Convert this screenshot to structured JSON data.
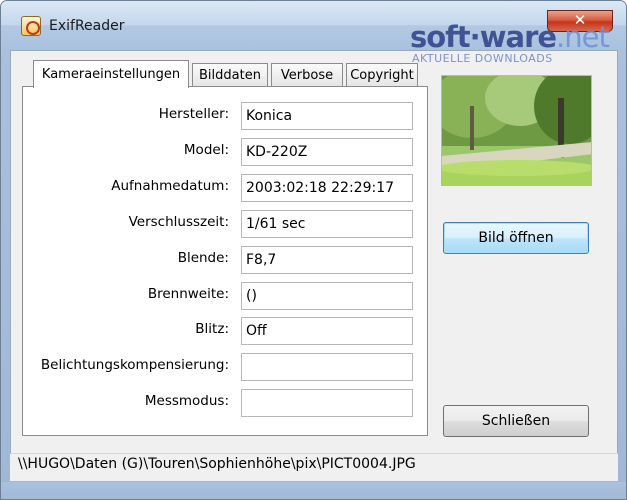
{
  "window": {
    "title": "ExifReader",
    "close_glyph": "✕"
  },
  "watermark": {
    "brand_main": "soft",
    "brand_sep": "·",
    "brand_mid": "ware",
    "brand_tld": ".net",
    "tagline": "AKTUELLE DOWNLOADS"
  },
  "tabs": [
    {
      "label": "Kameraeinstellungen",
      "active": true
    },
    {
      "label": "Bilddaten",
      "active": false
    },
    {
      "label": "Verbose",
      "active": false
    },
    {
      "label": "Copyright",
      "active": false
    }
  ],
  "fields": {
    "manufacturer": {
      "label": "Hersteller:",
      "value": "Konica"
    },
    "model": {
      "label": "Model:",
      "value": "KD-220Z"
    },
    "date_taken": {
      "label": "Aufnahmedatum:",
      "value": "2003:02:18 22:29:17"
    },
    "shutter": {
      "label": "Verschlusszeit:",
      "value": "1/61 sec"
    },
    "aperture": {
      "label": "Blende:",
      "value": "F8,7"
    },
    "focal_length": {
      "label": "Brennweite:",
      "value": "()"
    },
    "flash": {
      "label": "Blitz:",
      "value": "Off"
    },
    "exposure_comp": {
      "label": "Belichtungskompensierung:",
      "value": ""
    },
    "metering": {
      "label": "Messmodus:",
      "value": ""
    }
  },
  "buttons": {
    "open_image": "Bild öffnen",
    "close": "Schließen"
  },
  "status": {
    "path": "\\\\HUGO\\Daten (G)\\Touren\\Sophienhöhe\\pix\\PICT0004.JPG"
  },
  "icons": {
    "app": "exifreader-app-icon",
    "preview": "park-photo-preview"
  },
  "colors": {
    "accent": "#3c7fb1",
    "close_red": "#c6331a",
    "watermark_blue": "#2e3f86"
  }
}
